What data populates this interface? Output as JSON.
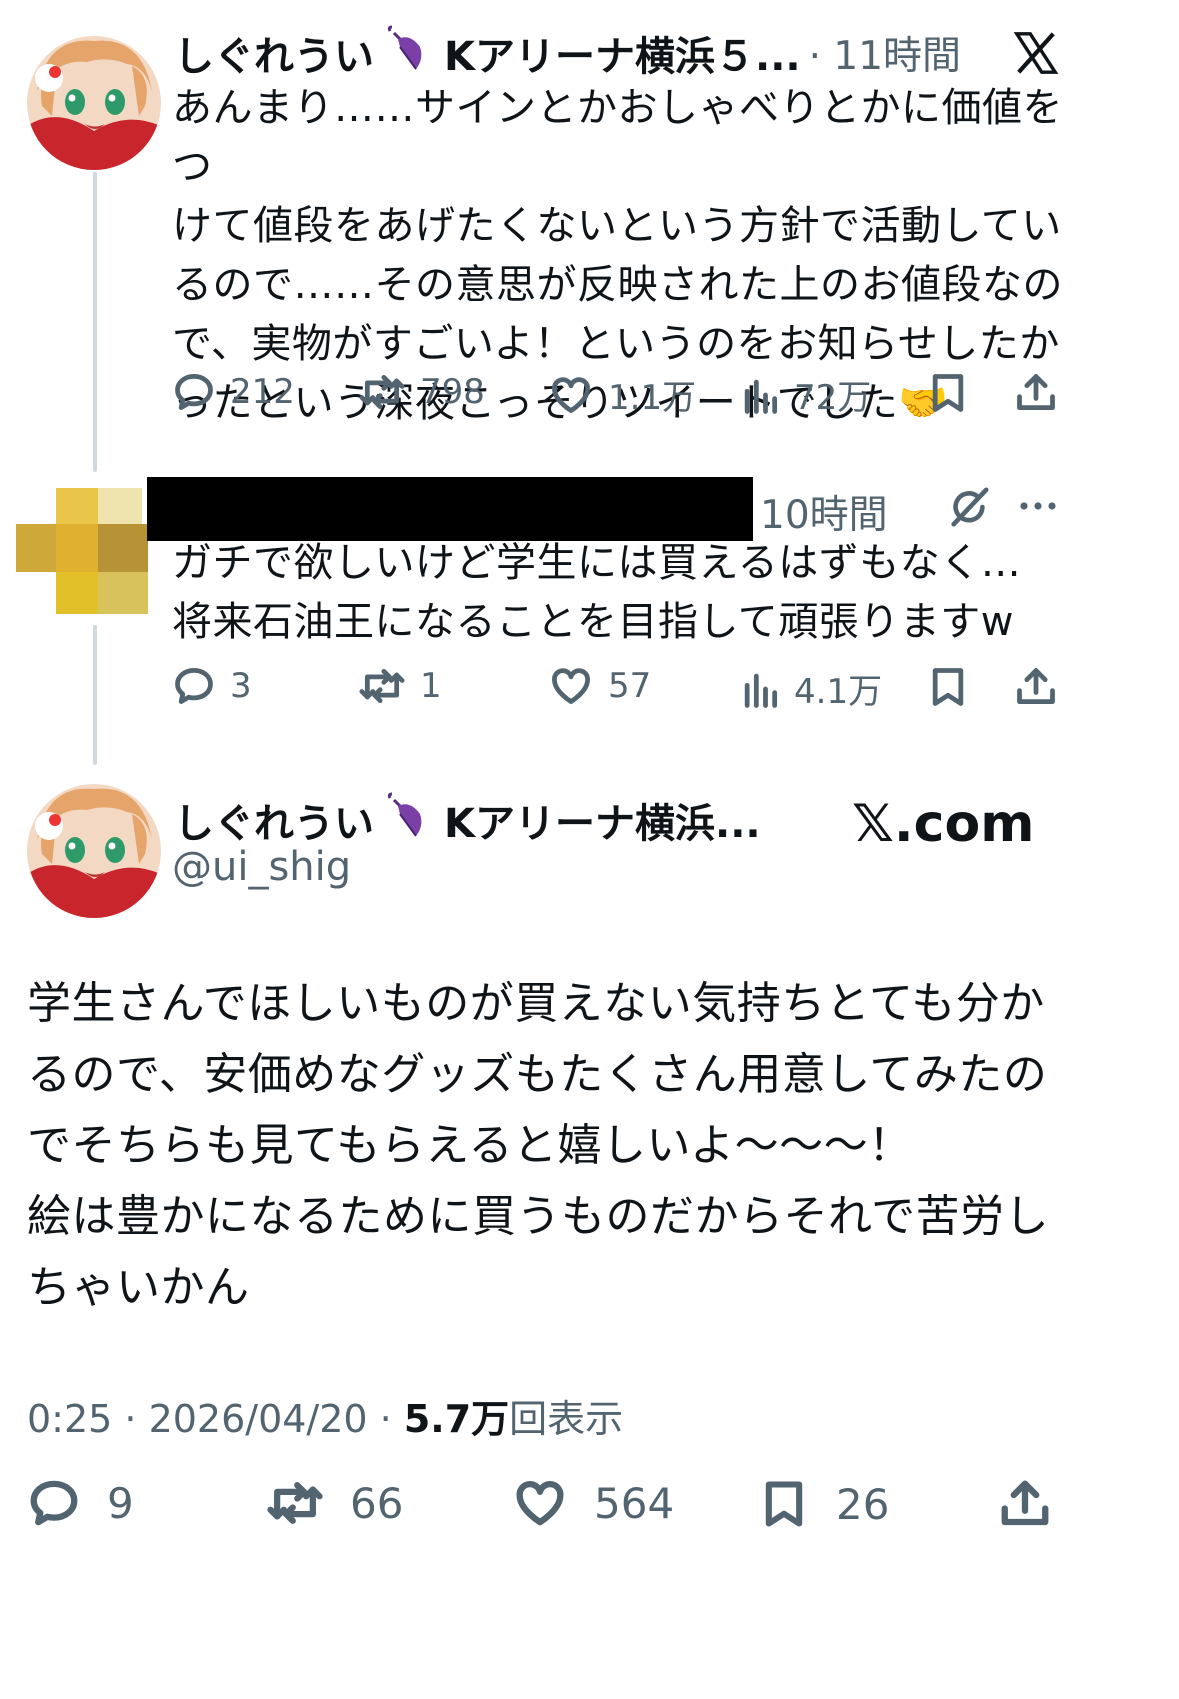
{
  "tweet1": {
    "name": "しぐれうい",
    "name_suffix": "Kアリーナ横浜５...",
    "time": "· 11時間",
    "text": "あんまり……サインとかおしゃべりとかに価値をつ\nけて値段をあげたくないという方針で活動してい\nるので……その意思が反映された上のお値段なの\nで、実物がすごいよ！というのをお知らせしたか\nったという深夜こっそりツイートでした🤝",
    "replies": "212",
    "retweets": "798",
    "likes": "1.1万",
    "views": "72万",
    "icons": {
      "reply": "reply-icon",
      "retweet": "retweet-icon",
      "like": "heart-icon",
      "views": "views-icon",
      "bookmark": "bookmark-icon",
      "share": "share-icon",
      "x_logo": "x-logo-icon",
      "emoji": "handshake-emoji"
    }
  },
  "tweet2": {
    "time": "10時間",
    "text": "ガチで欲しいけど学生には買えるはずもなく…\n将来石油王になることを目指して頑張りますw",
    "replies": "3",
    "retweets": "1",
    "likes": "57",
    "views": "4.1万",
    "icons": {
      "grok": "grok-icon",
      "more": "more-icon"
    }
  },
  "main_tweet": {
    "name": "しぐれうい",
    "name_suffix": "Kアリーナ横浜...",
    "handle": "@ui_shig",
    "brand": "𝕏.com",
    "text": "学生さんでほしいものが買えない気持ちとても分か\nるので、安価めなグッズもたくさん用意してみたの\nでそちらも見てもらえると嬉しいよ〜〜〜！\n絵は豊かになるために買うものだからそれで苦労し\nちゃいかん",
    "timestamp": "0:25 · 2026/04/20 · ",
    "views_count": "5.7万",
    "views_label": "回表示",
    "replies": "9",
    "retweets": "66",
    "likes": "564",
    "bookmarks": "26"
  },
  "colors": {
    "text": "#0f1419",
    "secondary": "#536471",
    "thread_line": "#cfd9de"
  }
}
